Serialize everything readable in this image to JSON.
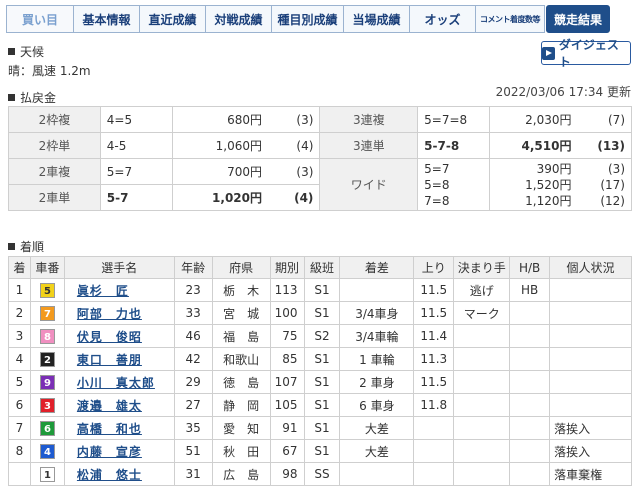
{
  "tabs": [
    {
      "label": "買い目",
      "style": "kaime",
      "w": 68
    },
    {
      "label": "基本情報",
      "style": "",
      "w": 67
    },
    {
      "label": "直近成績",
      "style": "",
      "w": 67
    },
    {
      "label": "対戦成績",
      "style": "",
      "w": 67
    },
    {
      "label": "種目別成績",
      "style": "",
      "w": 73
    },
    {
      "label": "当場成績",
      "style": "",
      "w": 67
    },
    {
      "label": "オッズ",
      "style": "",
      "w": 67
    },
    {
      "label": "コメント着度数等",
      "style": "small",
      "w": 70
    },
    {
      "label": "競走結果",
      "style": "active",
      "w": 64
    }
  ],
  "weather": {
    "section_label": "天候",
    "text": "晴：風速 1.2m"
  },
  "digest_label": "ダイジェスト",
  "updated": "2022/03/06 17:34 更新",
  "payout": {
    "section_label": "払戻金",
    "rows": [
      {
        "l_label": "2枠複",
        "l_comb": "4=5",
        "l_yen": "680円",
        "l_pop": "(3)",
        "l_bold": false,
        "r_label": "3連複",
        "r_comb": "5=7=8",
        "r_yen": "2,030円",
        "r_pop": "(7)",
        "r_bold": false
      },
      {
        "l_label": "2枠単",
        "l_comb": "4-5",
        "l_yen": "1,060円",
        "l_pop": "(4)",
        "l_bold": false,
        "r_label": "3連単",
        "r_comb": "5-7-8",
        "r_yen": "4,510円",
        "r_pop": "(13)",
        "r_bold": true
      },
      {
        "l_label": "2車複",
        "l_comb": "5=7",
        "l_yen": "700円",
        "l_pop": "(3)",
        "l_bold": false
      },
      {
        "l_label": "2車単",
        "l_comb": "5-7",
        "l_yen": "1,020円",
        "l_pop": "(4)",
        "l_bold": true
      }
    ],
    "wide": {
      "label": "ワイド",
      "items": [
        {
          "comb": "5=7",
          "yen": "390円",
          "pop": "(3)"
        },
        {
          "comb": "5=8",
          "yen": "1,520円",
          "pop": "(17)"
        },
        {
          "comb": "7=8",
          "yen": "1,120円",
          "pop": "(12)"
        }
      ]
    }
  },
  "results": {
    "section_label": "着順",
    "headers": [
      "着",
      "車番",
      "選手名",
      "年齢",
      "府県",
      "期別",
      "級班",
      "着差",
      "上り",
      "決まり手",
      "H/B",
      "個人状況"
    ],
    "rows": [
      {
        "rank": "1",
        "car": "5",
        "name": "眞杉　匠",
        "age": "23",
        "pref": "栃　木",
        "term": "113",
        "class": "S1",
        "margin": "",
        "agari": "11.5",
        "kimarite": "逃げ",
        "hb": "HB",
        "status": ""
      },
      {
        "rank": "2",
        "car": "7",
        "name": "阿部　力也",
        "age": "33",
        "pref": "宮　城",
        "term": "100",
        "class": "S1",
        "margin": "3/4車身",
        "agari": "11.5",
        "kimarite": "マーク",
        "hb": "",
        "status": ""
      },
      {
        "rank": "3",
        "car": "8",
        "name": "伏見　俊昭",
        "age": "46",
        "pref": "福　島",
        "term": "75",
        "class": "S2",
        "margin": "3/4車輪",
        "agari": "11.4",
        "kimarite": "",
        "hb": "",
        "status": ""
      },
      {
        "rank": "4",
        "car": "2",
        "name": "東口　善朋",
        "age": "42",
        "pref": "和歌山",
        "term": "85",
        "class": "S1",
        "margin": "1 車輪",
        "agari": "11.3",
        "kimarite": "",
        "hb": "",
        "status": ""
      },
      {
        "rank": "5",
        "car": "9",
        "name": "小川　真太郎",
        "age": "29",
        "pref": "徳　島",
        "term": "107",
        "class": "S1",
        "margin": "2 車身",
        "agari": "11.5",
        "kimarite": "",
        "hb": "",
        "status": ""
      },
      {
        "rank": "6",
        "car": "3",
        "name": "渡邉　雄太",
        "age": "27",
        "pref": "静　岡",
        "term": "105",
        "class": "S1",
        "margin": "6 車身",
        "agari": "11.8",
        "kimarite": "",
        "hb": "",
        "status": ""
      },
      {
        "rank": "7",
        "car": "6",
        "name": "高橋　和也",
        "age": "35",
        "pref": "愛　知",
        "term": "91",
        "class": "S1",
        "margin": "大差",
        "agari": "",
        "kimarite": "",
        "hb": "",
        "status": "落挨入"
      },
      {
        "rank": "8",
        "car": "4",
        "name": "内藤　宣彦",
        "age": "51",
        "pref": "秋　田",
        "term": "67",
        "class": "S1",
        "margin": "大差",
        "agari": "",
        "kimarite": "",
        "hb": "",
        "status": "落挨入"
      },
      {
        "rank": "",
        "car": "1",
        "name": "松浦　悠士",
        "age": "31",
        "pref": "広　島",
        "term": "98",
        "class": "SS",
        "margin": "",
        "agari": "",
        "kimarite": "",
        "hb": "",
        "status": "落車棄権"
      }
    ]
  },
  "car_colors": {
    "1": {
      "bg": "#ffffff",
      "fg": "#333333"
    },
    "2": {
      "bg": "#222222",
      "fg": "#ffffff"
    },
    "3": {
      "bg": "#e0202a",
      "fg": "#ffffff"
    },
    "4": {
      "bg": "#1e5bd0",
      "fg": "#ffffff"
    },
    "5": {
      "bg": "#f2d21a",
      "fg": "#333333"
    },
    "6": {
      "bg": "#1e9a3a",
      "fg": "#ffffff"
    },
    "7": {
      "bg": "#f39a1e",
      "fg": "#ffffff"
    },
    "8": {
      "bg": "#f08fc0",
      "fg": "#ffffff"
    },
    "9": {
      "bg": "#7b2fb5",
      "fg": "#ffffff"
    }
  }
}
